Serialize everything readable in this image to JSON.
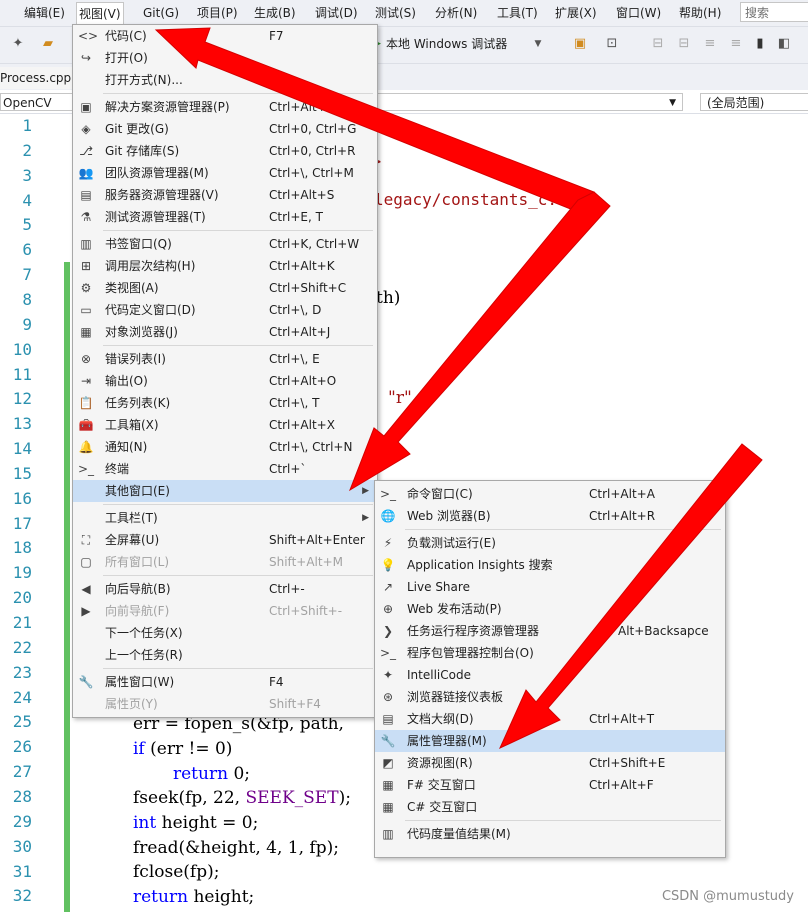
{
  "menubar": {
    "items": [
      "编辑(E)",
      "视图(V)",
      "Git(G)",
      "项目(P)",
      "生成(B)",
      "调试(D)",
      "测试(S)",
      "分析(N)",
      "工具(T)",
      "扩展(X)",
      "窗口(W)",
      "帮助(H)"
    ],
    "search_placeholder": "搜索 (Ctrl+Q)"
  },
  "toolbar": {
    "run_label": "本地 Windows 调试器"
  },
  "tabs": {
    "file": "Process.cpp"
  },
  "navbar": {
    "project": "OpenCV",
    "scope": "(全局范围)"
  },
  "editor": {
    "line_numbers": [
      "1",
      "2",
      "3",
      "4",
      "5",
      "6",
      "7",
      "8",
      "9",
      "10",
      "11",
      "12",
      "13",
      "14",
      "15",
      "16",
      "17",
      "18",
      "19",
      "20",
      "21",
      "22",
      "23",
      "24",
      "25",
      "26",
      "27",
      "28",
      "29",
      "30",
      "31",
      "32"
    ],
    "fragments": {
      "l3": ">",
      "l4": "legacy/constants_c.",
      "l8": "th)",
      "l12": "\"r\""
    },
    "lines": {
      "l25": {
        "a": "err = fopen_s(&fp, path,"
      },
      "l26": {
        "kw": "if",
        "rest": " (err != 0)"
      },
      "l27": {
        "kw": "return",
        "rest": " 0;"
      },
      "l28": {
        "a": "fseek(fp, 22, ",
        "mac": "SEEK_SET",
        "b": ");"
      },
      "l29": {
        "kw": "int",
        "rest": " height = 0;"
      },
      "l30": {
        "a": "fread(&height, 4, 1, fp);"
      },
      "l31": {
        "a": "fclose(fp);"
      },
      "l32": {
        "kw": "return",
        "rest": " height;"
      }
    }
  },
  "view_menu": {
    "items": [
      {
        "icon": "code-icon",
        "glyph": "<>",
        "label": "代码(C)",
        "shortcut": "F7"
      },
      {
        "icon": "open-icon",
        "glyph": "↪",
        "label": "打开(O)",
        "shortcut": ""
      },
      {
        "icon": "",
        "glyph": "",
        "label": "打开方式(N)...",
        "shortcut": ""
      },
      {
        "icon": "solution-explorer-icon",
        "glyph": "▣",
        "label": "解决方案资源管理器(P)",
        "shortcut": "Ctrl+Alt+L"
      },
      {
        "icon": "git-changes-icon",
        "glyph": "◈",
        "label": "Git 更改(G)",
        "shortcut": "Ctrl+0, Ctrl+G"
      },
      {
        "icon": "git-repo-icon",
        "glyph": "⎇",
        "label": "Git 存储库(S)",
        "shortcut": "Ctrl+0, Ctrl+R"
      },
      {
        "icon": "team-explorer-icon",
        "glyph": "👥",
        "label": "团队资源管理器(M)",
        "shortcut": "Ctrl+\\, Ctrl+M"
      },
      {
        "icon": "server-explorer-icon",
        "glyph": "▤",
        "label": "服务器资源管理器(V)",
        "shortcut": "Ctrl+Alt+S"
      },
      {
        "icon": "test-explorer-icon",
        "glyph": "⚗",
        "label": "测试资源管理器(T)",
        "shortcut": "Ctrl+E, T"
      },
      {
        "icon": "bookmark-window-icon",
        "glyph": "▥",
        "label": "书签窗口(Q)",
        "shortcut": "Ctrl+K, Ctrl+W"
      },
      {
        "icon": "call-hierarchy-icon",
        "glyph": "⊞",
        "label": "调用层次结构(H)",
        "shortcut": "Ctrl+Alt+K"
      },
      {
        "icon": "class-view-icon",
        "glyph": "⚙",
        "label": "类视图(A)",
        "shortcut": "Ctrl+Shift+C"
      },
      {
        "icon": "code-definition-icon",
        "glyph": "▭",
        "label": "代码定义窗口(D)",
        "shortcut": "Ctrl+\\, D"
      },
      {
        "icon": "object-browser-icon",
        "glyph": "▦",
        "label": "对象浏览器(J)",
        "shortcut": "Ctrl+Alt+J"
      },
      {
        "icon": "error-list-icon",
        "glyph": "⊗",
        "label": "错误列表(I)",
        "shortcut": "Ctrl+\\, E"
      },
      {
        "icon": "output-icon",
        "glyph": "⇥",
        "label": "输出(O)",
        "shortcut": "Ctrl+Alt+O"
      },
      {
        "icon": "task-list-icon",
        "glyph": "📋",
        "label": "任务列表(K)",
        "shortcut": "Ctrl+\\, T"
      },
      {
        "icon": "toolbox-icon",
        "glyph": "🧰",
        "label": "工具箱(X)",
        "shortcut": "Ctrl+Alt+X"
      },
      {
        "icon": "notification-bell-icon",
        "glyph": "🔔",
        "label": "通知(N)",
        "shortcut": "Ctrl+\\, Ctrl+N"
      },
      {
        "icon": "terminal-icon",
        "glyph": ">_",
        "label": "终端",
        "shortcut": "Ctrl+`"
      },
      {
        "icon": "",
        "glyph": "",
        "label": "其他窗口(E)",
        "shortcut": ""
      },
      {
        "icon": "",
        "glyph": "",
        "label": "工具栏(T)",
        "shortcut": ""
      },
      {
        "icon": "fullscreen-icon",
        "glyph": "⛶",
        "label": "全屏幕(U)",
        "shortcut": "Shift+Alt+Enter"
      },
      {
        "icon": "all-windows-icon",
        "glyph": "▢",
        "label": "所有窗口(L)",
        "shortcut": "Shift+Alt+M"
      },
      {
        "icon": "navigate-back-icon",
        "glyph": "◀",
        "label": "向后导航(B)",
        "shortcut": "Ctrl+-"
      },
      {
        "icon": "navigate-forward-icon",
        "glyph": "▶",
        "label": "向前导航(F)",
        "shortcut": "Ctrl+Shift+-"
      },
      {
        "icon": "",
        "glyph": "",
        "label": "下一个任务(X)",
        "shortcut": ""
      },
      {
        "icon": "",
        "glyph": "",
        "label": "上一个任务(R)",
        "shortcut": ""
      },
      {
        "icon": "properties-wrench-icon",
        "glyph": "🔧",
        "label": "属性窗口(W)",
        "shortcut": "F4"
      },
      {
        "icon": "",
        "glyph": "",
        "label": "属性页(Y)",
        "shortcut": "Shift+F4"
      }
    ]
  },
  "other_windows_menu": {
    "items": [
      {
        "icon": "command-window-icon",
        "glyph": ">_",
        "label": "命令窗口(C)",
        "shortcut": "Ctrl+Alt+A"
      },
      {
        "icon": "web-browser-icon",
        "glyph": "🌐",
        "label": "Web 浏览器(B)",
        "shortcut": "Ctrl+Alt+R"
      },
      {
        "icon": "load-test-icon",
        "glyph": "⚡",
        "label": "负载测试运行(E)",
        "shortcut": ""
      },
      {
        "icon": "insights-bulb-icon",
        "glyph": "💡",
        "label": "Application Insights 搜索",
        "shortcut": ""
      },
      {
        "icon": "live-share-icon",
        "glyph": "↗",
        "label": "Live Share",
        "shortcut": ""
      },
      {
        "icon": "web-publish-icon",
        "glyph": "⊕",
        "label": "Web 发布活动(P)",
        "shortcut": ""
      },
      {
        "icon": "task-runner-icon",
        "glyph": "❯",
        "label": "任务运行程序资源管理器",
        "shortcut": "Alt+Backsapce"
      },
      {
        "icon": "package-console-icon",
        "glyph": ">_",
        "label": "程序包管理器控制台(O)",
        "shortcut": ""
      },
      {
        "icon": "intellicode-icon",
        "glyph": "✦",
        "label": "IntelliCode",
        "shortcut": ""
      },
      {
        "icon": "browser-link-icon",
        "glyph": "⊛",
        "label": "浏览器链接仪表板",
        "shortcut": ""
      },
      {
        "icon": "document-outline-icon",
        "glyph": "▤",
        "label": "文档大纲(D)",
        "shortcut": "Ctrl+Alt+T"
      },
      {
        "icon": "property-manager-wrench-icon",
        "glyph": "🔧",
        "label": "属性管理器(M)",
        "shortcut": ""
      },
      {
        "icon": "resource-view-icon",
        "glyph": "◩",
        "label": "资源视图(R)",
        "shortcut": "Ctrl+Shift+E"
      },
      {
        "icon": "fsharp-interactive-icon",
        "glyph": "▦",
        "label": "F# 交互窗口",
        "shortcut": "Ctrl+Alt+F"
      },
      {
        "icon": "csharp-interactive-icon",
        "glyph": "▦",
        "label": "C# 交互窗口",
        "shortcut": ""
      },
      {
        "icon": "code-metrics-icon",
        "glyph": "▥",
        "label": "代码度量值结果(M)",
        "shortcut": ""
      }
    ]
  },
  "watermark": "CSDN @mumustudy",
  "colors": {
    "highlight": "#c9def5",
    "arrow": "#ff0000",
    "change_bar": "#61c161"
  }
}
